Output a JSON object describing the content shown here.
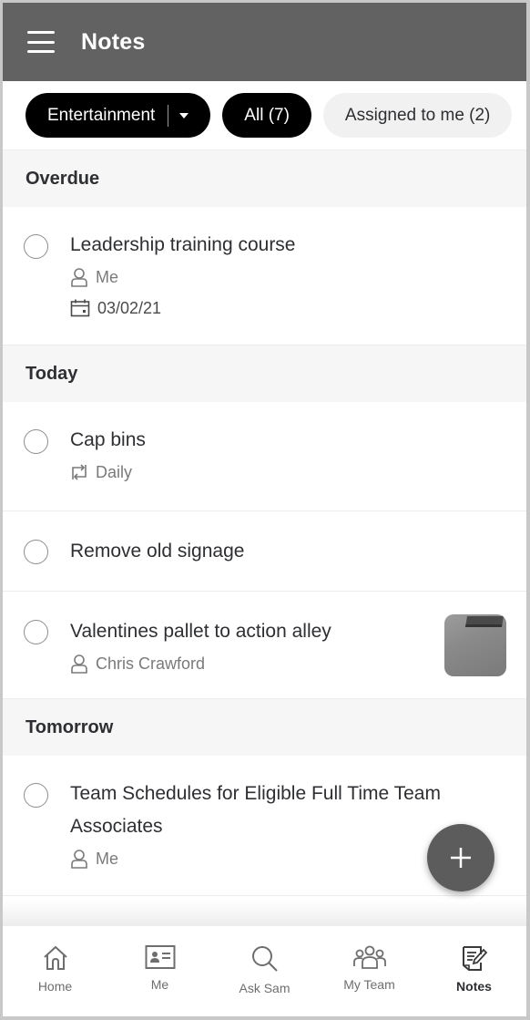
{
  "app": {
    "title": "Notes",
    "icons": {
      "menu": "hamburger-menu-icon"
    }
  },
  "filters": {
    "department": {
      "label": "Entertainment",
      "icon": "caret-down-icon"
    },
    "chips": [
      {
        "label": "All (7)",
        "selected": true
      },
      {
        "label": "Assigned to me (2)",
        "selected": false
      }
    ]
  },
  "sections": [
    {
      "title": "Overdue",
      "tasks": [
        {
          "title": "Leadership training course",
          "assignee": "Me",
          "due": "03/02/21",
          "completed": false
        }
      ]
    },
    {
      "title": "Today",
      "tasks": [
        {
          "title": "Cap bins",
          "recurrence": "Daily",
          "completed": false
        },
        {
          "title": "Remove old signage",
          "completed": false
        },
        {
          "title": "Valentines pallet to action alley",
          "assignee": "Chris Crawford",
          "has_image": true,
          "completed": false
        }
      ]
    },
    {
      "title": "Tomorrow",
      "tasks": [
        {
          "title": "Team Schedules for Eligible Full Time Team Associates",
          "assignee": "Me",
          "completed": false
        }
      ]
    }
  ],
  "fab": {
    "icon": "plus-icon",
    "action": "add-note"
  },
  "bottom_nav": [
    {
      "label": "Home",
      "icon": "home-icon",
      "active": false
    },
    {
      "label": "Me",
      "icon": "id-card-icon",
      "active": false
    },
    {
      "label": "Ask Sam",
      "icon": "search-icon",
      "active": false
    },
    {
      "label": "My Team",
      "icon": "team-icon",
      "active": false
    },
    {
      "label": "Notes",
      "icon": "notes-edit-icon",
      "active": true
    }
  ],
  "colors": {
    "header_bg": "#626262",
    "chip_selected_bg": "#000000",
    "chip_unselected_bg": "#f1f1f1",
    "section_bg": "#f6f6f6",
    "fab_bg": "#5c5c5c"
  }
}
